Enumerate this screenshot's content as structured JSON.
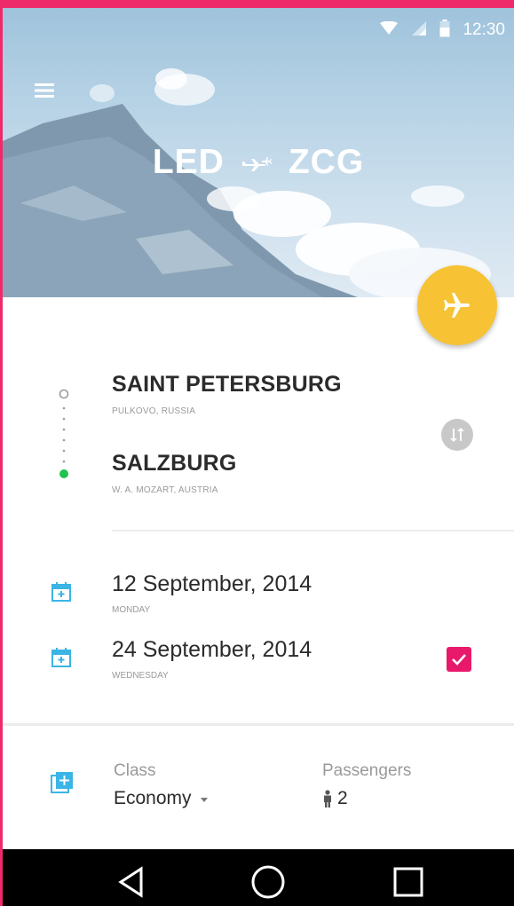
{
  "status_bar": {
    "time": "12:30"
  },
  "header": {
    "origin_code": "LED",
    "destination_code": "ZCG"
  },
  "route": {
    "origin": {
      "city": "SAINT PETERSBURG",
      "airport": "PULKOVO, RUSSIA"
    },
    "destination": {
      "city": "SALZBURG",
      "airport": "W. A. MOZART, AUSTRIA"
    }
  },
  "dates": {
    "departure": {
      "date": "12 September, 2014",
      "weekday": "MONDAY"
    },
    "return": {
      "date": "24 September, 2014",
      "weekday": "WEDNESDAY",
      "checked": true
    }
  },
  "options": {
    "class_label": "Class",
    "class_value": "Economy",
    "passengers_label": "Passengers",
    "passengers_value": "2"
  },
  "colors": {
    "accent_pink": "#ee2a6b",
    "fab_yellow": "#f7c233",
    "icon_blue": "#3ab5e6",
    "timeline_green": "#1fc24b"
  },
  "icons": [
    "wifi-icon",
    "signal-icon",
    "battery-icon",
    "menu-icon",
    "plane-icon",
    "swap-icon",
    "calendar-icon",
    "class-icon",
    "person-icon",
    "back-icon",
    "home-icon",
    "recents-icon"
  ]
}
